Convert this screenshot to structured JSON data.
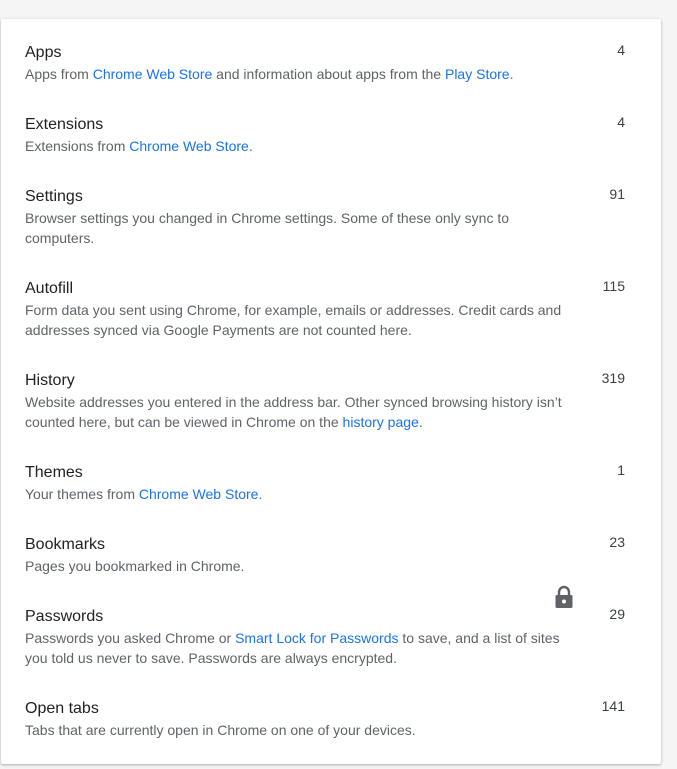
{
  "rows": [
    {
      "title": "Apps",
      "desc_parts": [
        {
          "text": "Apps from "
        },
        {
          "text": "Chrome Web Store",
          "link": true
        },
        {
          "text": " and information about apps from the "
        },
        {
          "text": "Play Store",
          "link": true
        },
        {
          "text": "."
        }
      ],
      "count": "4"
    },
    {
      "title": "Extensions",
      "desc_parts": [
        {
          "text": "Extensions from "
        },
        {
          "text": "Chrome Web Store",
          "link": true
        },
        {
          "text": "."
        }
      ],
      "count": "4"
    },
    {
      "title": "Settings",
      "desc_parts": [
        {
          "text": "Browser settings you changed in Chrome settings. Some of these only sync to computers."
        }
      ],
      "count": "91"
    },
    {
      "title": "Autofill",
      "desc_parts": [
        {
          "text": "Form data you sent using Chrome, for example, emails or addresses. Credit cards and addresses synced via Google Payments are not counted here."
        }
      ],
      "count": "115"
    },
    {
      "title": "History",
      "desc_parts": [
        {
          "text": "Website addresses you entered in the address bar. Other synced browsing history isn’t counted here, but can be viewed in Chrome on the "
        },
        {
          "text": "history page",
          "link": true
        },
        {
          "text": "."
        }
      ],
      "count": "319"
    },
    {
      "title": "Themes",
      "desc_parts": [
        {
          "text": "Your themes from "
        },
        {
          "text": "Chrome Web Store",
          "link": true
        },
        {
          "text": "."
        }
      ],
      "count": "1"
    },
    {
      "title": "Bookmarks",
      "desc_parts": [
        {
          "text": "Pages you bookmarked in Chrome."
        }
      ],
      "count": "23"
    },
    {
      "title": "Passwords",
      "desc_parts": [
        {
          "text": "Passwords you asked Chrome or "
        },
        {
          "text": "Smart Lock for Passwords",
          "link": true
        },
        {
          "text": " to save, and a list of sites you told us never to save. Passwords are always encrypted."
        }
      ],
      "count": "29",
      "icon": "lock-icon"
    },
    {
      "title": "Open tabs",
      "desc_parts": [
        {
          "text": "Tabs that are currently open in Chrome on one of your devices."
        }
      ],
      "count": "141"
    }
  ],
  "colors": {
    "link": "#1a73e8",
    "title": "#202124",
    "description": "#5f6368",
    "icon": "#5f6368"
  }
}
